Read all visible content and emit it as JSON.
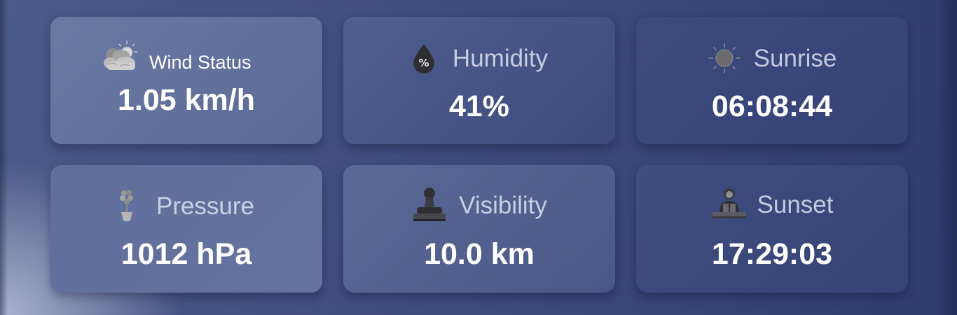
{
  "cards": [
    {
      "label": "Wind Status",
      "value": "1.05 km/h",
      "icon": "cloud-sun-icon"
    },
    {
      "label": "Humidity",
      "value": "41%",
      "icon": "humidity-drop-icon"
    },
    {
      "label": "Sunrise",
      "value": "06:08:44",
      "icon": "sun-icon"
    },
    {
      "label": "Pressure",
      "value": "1012 hPa",
      "icon": "plant-pot-icon"
    },
    {
      "label": "Visibility",
      "value": "10.0 km",
      "icon": "stamp-icon"
    },
    {
      "label": "Sunset",
      "value": "17:29:03",
      "icon": "person-desk-icon"
    }
  ],
  "colors": {
    "background_start": "#4b5a88",
    "background_end": "#2f3c6e",
    "value_text": "#ffffff",
    "label_text": "#e1e6f5"
  }
}
